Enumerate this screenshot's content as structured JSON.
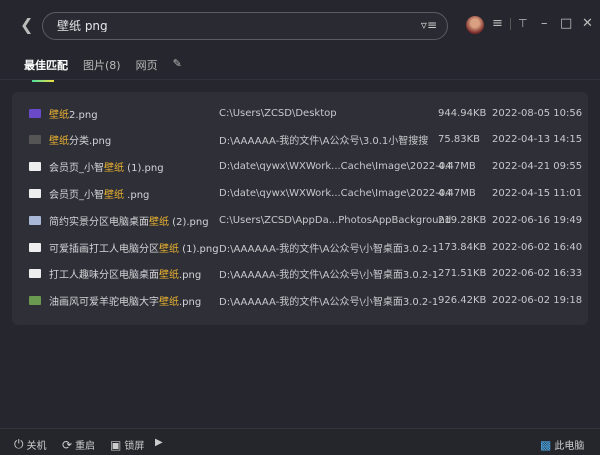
{
  "search": {
    "query": "壁纸 png"
  },
  "tabs": [
    {
      "label": "最佳匹配"
    },
    {
      "label": "图片(8)"
    },
    {
      "label": "网页"
    }
  ],
  "colors": {
    "highlight": "#e8b030",
    "background": "#26272e",
    "panel": "#2e2f37"
  },
  "results": [
    {
      "pre": "",
      "hl": "壁纸",
      "post": "2.png",
      "path": "C:\\Users\\ZCSD\\Desktop",
      "size": "944.94KB",
      "date": "2022-08-05 10:56",
      "icon": "image-thumb-purple"
    },
    {
      "pre": "",
      "hl": "壁纸",
      "post": "分类.png",
      "path": "D:\\AAAAAA-我的文件\\A公众号\\3.0.1小智搜搜",
      "size": "75.83KB",
      "date": "2022-04-13 14:15",
      "icon": "image-thumb-dark"
    },
    {
      "pre": "会员页_小智",
      "hl": "壁纸",
      "post": " (1).png",
      "path": "D:\\date\\qywx\\WXWork...Cache\\Image\\2022-04",
      "size": "4.47MB",
      "date": "2022-04-21 09:55",
      "icon": "image-thumb-white"
    },
    {
      "pre": "会员页_小智",
      "hl": "壁纸",
      "post": " .png",
      "path": "D:\\date\\qywx\\WXWork...Cache\\Image\\2022-04",
      "size": "4.47MB",
      "date": "2022-04-15 11:01",
      "icon": "image-thumb-white"
    },
    {
      "pre": "简约实景分区电脑桌面",
      "hl": "壁纸",
      "post": " (2).png",
      "path": "C:\\Users\\ZCSD\\AppDa...PhotosAppBackground",
      "size": "219.28KB",
      "date": "2022-06-16 19:49",
      "icon": "image-thumb-blue"
    },
    {
      "pre": "可爱插画打工人电脑分区",
      "hl": "壁纸",
      "post": " (1).png",
      "path": "D:\\AAAAAA-我的文件\\A公众号\\小智桌面3.0.2-1",
      "size": "173.84KB",
      "date": "2022-06-02 16:40",
      "icon": "image-thumb-white"
    },
    {
      "pre": "打工人趣味分区电脑桌面",
      "hl": "壁纸",
      "post": ".png",
      "path": "D:\\AAAAAA-我的文件\\A公众号\\小智桌面3.0.2-1",
      "size": "271.51KB",
      "date": "2022-06-02 16:33",
      "icon": "image-thumb-white"
    },
    {
      "pre": "油画风可爱羊驼电脑大字",
      "hl": "壁纸",
      "post": ".png",
      "path": "D:\\AAAAAA-我的文件\\A公众号\\小智桌面3.0.2-1",
      "size": "926.42KB",
      "date": "2022-06-02 19:18",
      "icon": "image-thumb-green"
    }
  ],
  "bottom": {
    "shutdown": "关机",
    "restart": "重启",
    "lock": "锁屏",
    "this_pc": "此电脑"
  }
}
